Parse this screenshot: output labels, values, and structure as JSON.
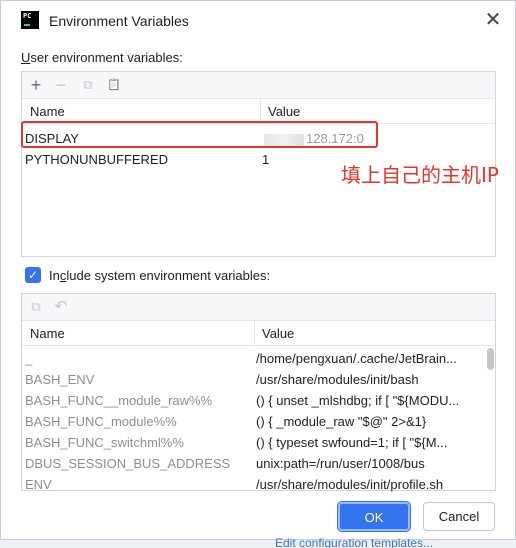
{
  "dialog": {
    "title": "Environment Variables",
    "logo_text": "PC",
    "close_glyph": "✕"
  },
  "user_section": {
    "label_prefix": "U",
    "label_rest": "ser environment variables:",
    "toolbar": {
      "add": "+",
      "remove": "−",
      "copy": "⧉",
      "paste": "📋"
    },
    "columns": {
      "name": "Name",
      "value": "Value"
    },
    "rows": [
      {
        "name": "DISPLAY",
        "value": "128.172:0"
      },
      {
        "name": "PYTHONUNBUFFERED",
        "value": "1"
      }
    ]
  },
  "annotation": "填上自己的主机IP",
  "system_section": {
    "checkbox_checked": true,
    "label_prefix": "In",
    "label_ul": "c",
    "label_rest": "lude system environment variables:",
    "columns": {
      "name": "Name",
      "value": "Value"
    },
    "rows": [
      {
        "name": "_",
        "value": "/home/pengxuan/.cache/JetBrain..."
      },
      {
        "name": "BASH_ENV",
        "value": "/usr/share/modules/init/bash"
      },
      {
        "name": "BASH_FUNC__module_raw%%",
        "value": "() {  unset _mlshdbg; if [ \"${MODU..."
      },
      {
        "name": "BASH_FUNC_module%%",
        "value": "() {  _module_raw \"$@\" 2>&1}"
      },
      {
        "name": "BASH_FUNC_switchml%%",
        "value": "() {  typeset swfound=1; if [ \"${M..."
      },
      {
        "name": "DBUS_SESSION_BUS_ADDRESS",
        "value": "unix:path=/run/user/1008/bus"
      },
      {
        "name": "ENV",
        "value": "/usr/share/modules/init/profile.sh"
      }
    ]
  },
  "buttons": {
    "ok": "OK",
    "cancel": "Cancel"
  },
  "background_link": "Edit configuration templates...",
  "colors": {
    "accent": "#3574f0",
    "annotation": "#e8342b"
  }
}
